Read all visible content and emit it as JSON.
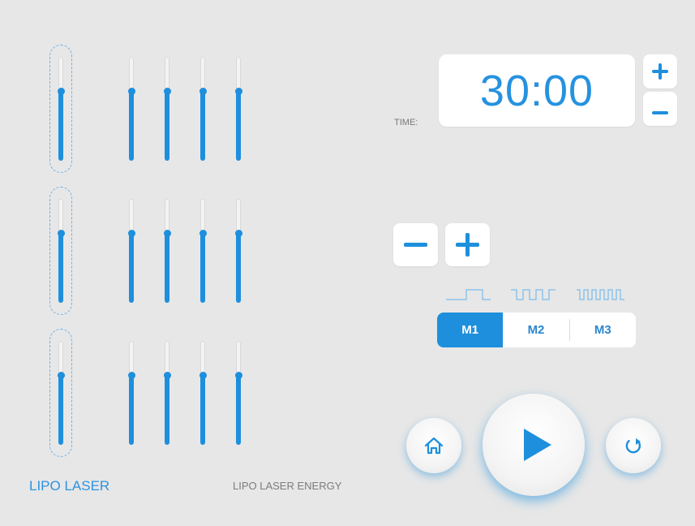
{
  "colors": {
    "accent": "#1e8fdc",
    "background": "#e7e7e7"
  },
  "sliders": {
    "rows": [
      {
        "values": [
          0.67,
          0.67,
          0.67,
          0.67,
          0.67
        ]
      },
      {
        "values": [
          0.67,
          0.67,
          0.67,
          0.67,
          0.67
        ]
      },
      {
        "values": [
          0.67,
          0.67,
          0.67,
          0.67,
          0.67
        ]
      }
    ]
  },
  "labels": {
    "lipo_laser": "LIPO LASER",
    "lipo_laser_energy": "LIPO LASER ENERGY",
    "time": "TIME:"
  },
  "timer": {
    "value": "30:00"
  },
  "modes": {
    "items": [
      "M1",
      "M2",
      "M3"
    ],
    "selected": "M1"
  },
  "icons": {
    "increase": "plus-icon",
    "decrease": "minus-icon",
    "home": "home-icon",
    "play": "play-icon",
    "reset": "refresh-icon"
  }
}
